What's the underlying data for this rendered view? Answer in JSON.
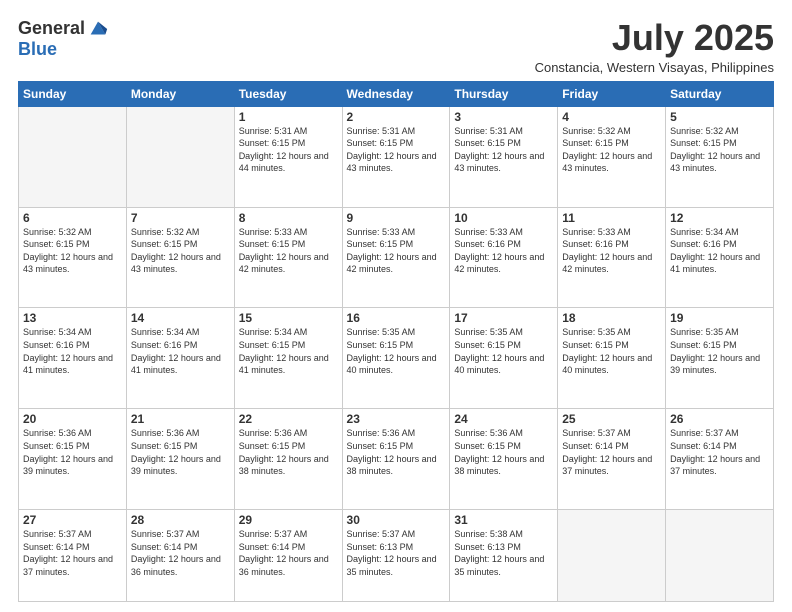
{
  "logo": {
    "general": "General",
    "blue": "Blue"
  },
  "header": {
    "title": "July 2025",
    "subtitle": "Constancia, Western Visayas, Philippines"
  },
  "weekdays": [
    "Sunday",
    "Monday",
    "Tuesday",
    "Wednesday",
    "Thursday",
    "Friday",
    "Saturday"
  ],
  "weeks": [
    [
      {
        "day": "",
        "empty": true
      },
      {
        "day": "",
        "empty": true
      },
      {
        "day": "1",
        "sunrise": "5:31 AM",
        "sunset": "6:15 PM",
        "daylight": "12 hours and 44 minutes."
      },
      {
        "day": "2",
        "sunrise": "5:31 AM",
        "sunset": "6:15 PM",
        "daylight": "12 hours and 43 minutes."
      },
      {
        "day": "3",
        "sunrise": "5:31 AM",
        "sunset": "6:15 PM",
        "daylight": "12 hours and 43 minutes."
      },
      {
        "day": "4",
        "sunrise": "5:32 AM",
        "sunset": "6:15 PM",
        "daylight": "12 hours and 43 minutes."
      },
      {
        "day": "5",
        "sunrise": "5:32 AM",
        "sunset": "6:15 PM",
        "daylight": "12 hours and 43 minutes."
      }
    ],
    [
      {
        "day": "6",
        "sunrise": "5:32 AM",
        "sunset": "6:15 PM",
        "daylight": "12 hours and 43 minutes."
      },
      {
        "day": "7",
        "sunrise": "5:32 AM",
        "sunset": "6:15 PM",
        "daylight": "12 hours and 43 minutes."
      },
      {
        "day": "8",
        "sunrise": "5:33 AM",
        "sunset": "6:15 PM",
        "daylight": "12 hours and 42 minutes."
      },
      {
        "day": "9",
        "sunrise": "5:33 AM",
        "sunset": "6:15 PM",
        "daylight": "12 hours and 42 minutes."
      },
      {
        "day": "10",
        "sunrise": "5:33 AM",
        "sunset": "6:16 PM",
        "daylight": "12 hours and 42 minutes."
      },
      {
        "day": "11",
        "sunrise": "5:33 AM",
        "sunset": "6:16 PM",
        "daylight": "12 hours and 42 minutes."
      },
      {
        "day": "12",
        "sunrise": "5:34 AM",
        "sunset": "6:16 PM",
        "daylight": "12 hours and 41 minutes."
      }
    ],
    [
      {
        "day": "13",
        "sunrise": "5:34 AM",
        "sunset": "6:16 PM",
        "daylight": "12 hours and 41 minutes."
      },
      {
        "day": "14",
        "sunrise": "5:34 AM",
        "sunset": "6:16 PM",
        "daylight": "12 hours and 41 minutes."
      },
      {
        "day": "15",
        "sunrise": "5:34 AM",
        "sunset": "6:15 PM",
        "daylight": "12 hours and 41 minutes."
      },
      {
        "day": "16",
        "sunrise": "5:35 AM",
        "sunset": "6:15 PM",
        "daylight": "12 hours and 40 minutes."
      },
      {
        "day": "17",
        "sunrise": "5:35 AM",
        "sunset": "6:15 PM",
        "daylight": "12 hours and 40 minutes."
      },
      {
        "day": "18",
        "sunrise": "5:35 AM",
        "sunset": "6:15 PM",
        "daylight": "12 hours and 40 minutes."
      },
      {
        "day": "19",
        "sunrise": "5:35 AM",
        "sunset": "6:15 PM",
        "daylight": "12 hours and 39 minutes."
      }
    ],
    [
      {
        "day": "20",
        "sunrise": "5:36 AM",
        "sunset": "6:15 PM",
        "daylight": "12 hours and 39 minutes."
      },
      {
        "day": "21",
        "sunrise": "5:36 AM",
        "sunset": "6:15 PM",
        "daylight": "12 hours and 39 minutes."
      },
      {
        "day": "22",
        "sunrise": "5:36 AM",
        "sunset": "6:15 PM",
        "daylight": "12 hours and 38 minutes."
      },
      {
        "day": "23",
        "sunrise": "5:36 AM",
        "sunset": "6:15 PM",
        "daylight": "12 hours and 38 minutes."
      },
      {
        "day": "24",
        "sunrise": "5:36 AM",
        "sunset": "6:15 PM",
        "daylight": "12 hours and 38 minutes."
      },
      {
        "day": "25",
        "sunrise": "5:37 AM",
        "sunset": "6:14 PM",
        "daylight": "12 hours and 37 minutes."
      },
      {
        "day": "26",
        "sunrise": "5:37 AM",
        "sunset": "6:14 PM",
        "daylight": "12 hours and 37 minutes."
      }
    ],
    [
      {
        "day": "27",
        "sunrise": "5:37 AM",
        "sunset": "6:14 PM",
        "daylight": "12 hours and 37 minutes."
      },
      {
        "day": "28",
        "sunrise": "5:37 AM",
        "sunset": "6:14 PM",
        "daylight": "12 hours and 36 minutes."
      },
      {
        "day": "29",
        "sunrise": "5:37 AM",
        "sunset": "6:14 PM",
        "daylight": "12 hours and 36 minutes."
      },
      {
        "day": "30",
        "sunrise": "5:37 AM",
        "sunset": "6:13 PM",
        "daylight": "12 hours and 35 minutes."
      },
      {
        "day": "31",
        "sunrise": "5:38 AM",
        "sunset": "6:13 PM",
        "daylight": "12 hours and 35 minutes."
      },
      {
        "day": "",
        "empty": true
      },
      {
        "day": "",
        "empty": true
      }
    ]
  ]
}
